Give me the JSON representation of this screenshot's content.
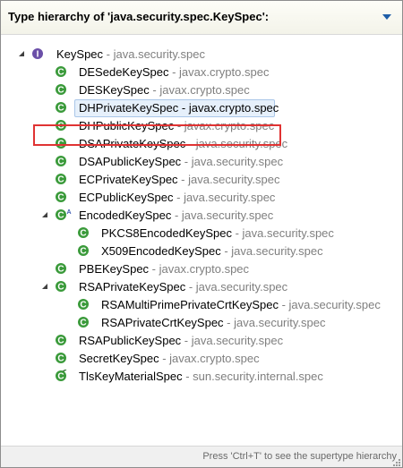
{
  "header": {
    "title": "Type hierarchy of 'java.security.spec.KeySpec':"
  },
  "tree": {
    "rows": [
      {
        "name": "KeySpec",
        "pkg": "java.security.spec",
        "icon": "interface-icon"
      },
      {
        "name": "DESedeKeySpec",
        "pkg": "javax.crypto.spec",
        "icon": "class-icon"
      },
      {
        "name": "DESKeySpec",
        "pkg": "javax.crypto.spec",
        "icon": "class-icon"
      },
      {
        "name": "DHPrivateKeySpec",
        "pkg": "javax.crypto.spec",
        "icon": "class-icon",
        "selected": true
      },
      {
        "name": "DHPublicKeySpec",
        "pkg": "javax.crypto.spec",
        "icon": "class-icon"
      },
      {
        "name": "DSAPrivateKeySpec",
        "pkg": "java.security.spec",
        "icon": "class-icon"
      },
      {
        "name": "DSAPublicKeySpec",
        "pkg": "java.security.spec",
        "icon": "class-icon"
      },
      {
        "name": "ECPrivateKeySpec",
        "pkg": "java.security.spec",
        "icon": "class-icon"
      },
      {
        "name": "ECPublicKeySpec",
        "pkg": "java.security.spec",
        "icon": "class-icon"
      },
      {
        "name": "EncodedKeySpec",
        "pkg": "java.security.spec",
        "icon": "abstract-class-icon"
      },
      {
        "name": "PKCS8EncodedKeySpec",
        "pkg": "java.security.spec",
        "icon": "class-icon"
      },
      {
        "name": "X509EncodedKeySpec",
        "pkg": "java.security.spec",
        "icon": "class-icon"
      },
      {
        "name": "PBEKeySpec",
        "pkg": "javax.crypto.spec",
        "icon": "class-icon"
      },
      {
        "name": "RSAPrivateKeySpec",
        "pkg": "java.security.spec",
        "icon": "class-icon"
      },
      {
        "name": "RSAMultiPrimePrivateCrtKeySpec",
        "pkg": "java.security.spec",
        "icon": "class-icon"
      },
      {
        "name": "RSAPrivateCrtKeySpec",
        "pkg": "java.security.spec",
        "icon": "class-icon"
      },
      {
        "name": "RSAPublicKeySpec",
        "pkg": "java.security.spec",
        "icon": "class-icon"
      },
      {
        "name": "SecretKeySpec",
        "pkg": "javax.crypto.spec",
        "icon": "class-icon"
      },
      {
        "name": "TlsKeyMaterialSpec",
        "pkg": "sun.security.internal.spec",
        "icon": "deprecated-class-icon"
      }
    ]
  },
  "status": {
    "hint": "Press 'Ctrl+T' to see the supertype hierarchy"
  },
  "colors": {
    "class_green": "#3a9a3a",
    "interface_purple": "#6b4fa8",
    "highlight_red": "#e03333",
    "package_gray": "#7f7f7f"
  }
}
